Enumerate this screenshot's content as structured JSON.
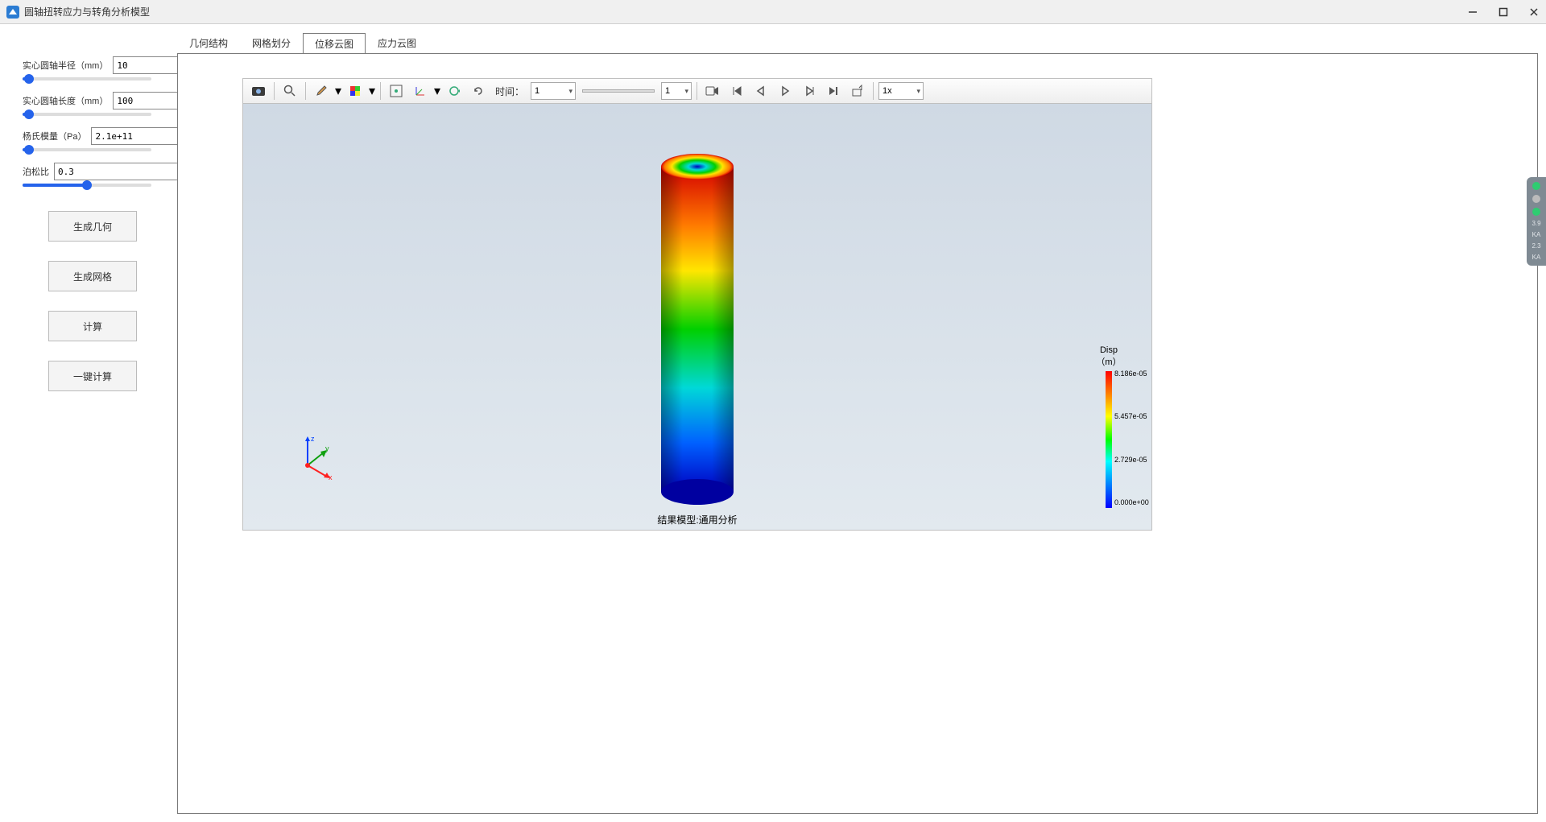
{
  "window": {
    "title": "圆轴扭转应力与转角分析模型"
  },
  "params": {
    "radius_label": "实心圆轴半径（mm）",
    "radius_value": "10",
    "length_label": "实心圆轴长度（mm）",
    "length_value": "100",
    "youngs_label": "杨氏模量（Pa）",
    "youngs_value": "2.1e+11",
    "poisson_label": "泊松比",
    "poisson_value": "0.3"
  },
  "actions": {
    "gen_geometry": "生成几何",
    "gen_mesh": "生成网格",
    "compute": "计算",
    "one_click": "一键计算"
  },
  "tabs": {
    "geometry": "几何结构",
    "mesh": "网格划分",
    "displacement": "位移云图",
    "stress": "应力云图"
  },
  "toolbar": {
    "time_label": "时间：",
    "time_select": "1",
    "frame_select": "1",
    "speed_select": "1x"
  },
  "viewport": {
    "caption": "结果模型:通用分析",
    "axes": {
      "x": "x",
      "y": "y",
      "z": "z"
    }
  },
  "legend": {
    "title": "Disp",
    "unit": "（m）",
    "ticks": [
      "8.186e-05",
      "5.457e-05",
      "2.729e-05",
      "0.000e+00"
    ]
  },
  "side_widget": {
    "val1": "3.9",
    "unit1": "KA",
    "val2": "2.3",
    "unit2": "KA"
  },
  "chart_data": {
    "type": "heatmap",
    "title": "Disp (m)",
    "description": "Torsional displacement magnitude contour on a solid circular shaft (3D cylinder). Displacement increases from the fixed bottom (0) to the top (max).",
    "colormap": "jet",
    "range": [
      0.0,
      8.186e-05
    ],
    "ticks": [
      0.0,
      2.729e-05,
      5.457e-05,
      8.186e-05
    ],
    "geometry": {
      "shape": "cylinder",
      "radius_mm": 10,
      "length_mm": 100
    }
  }
}
